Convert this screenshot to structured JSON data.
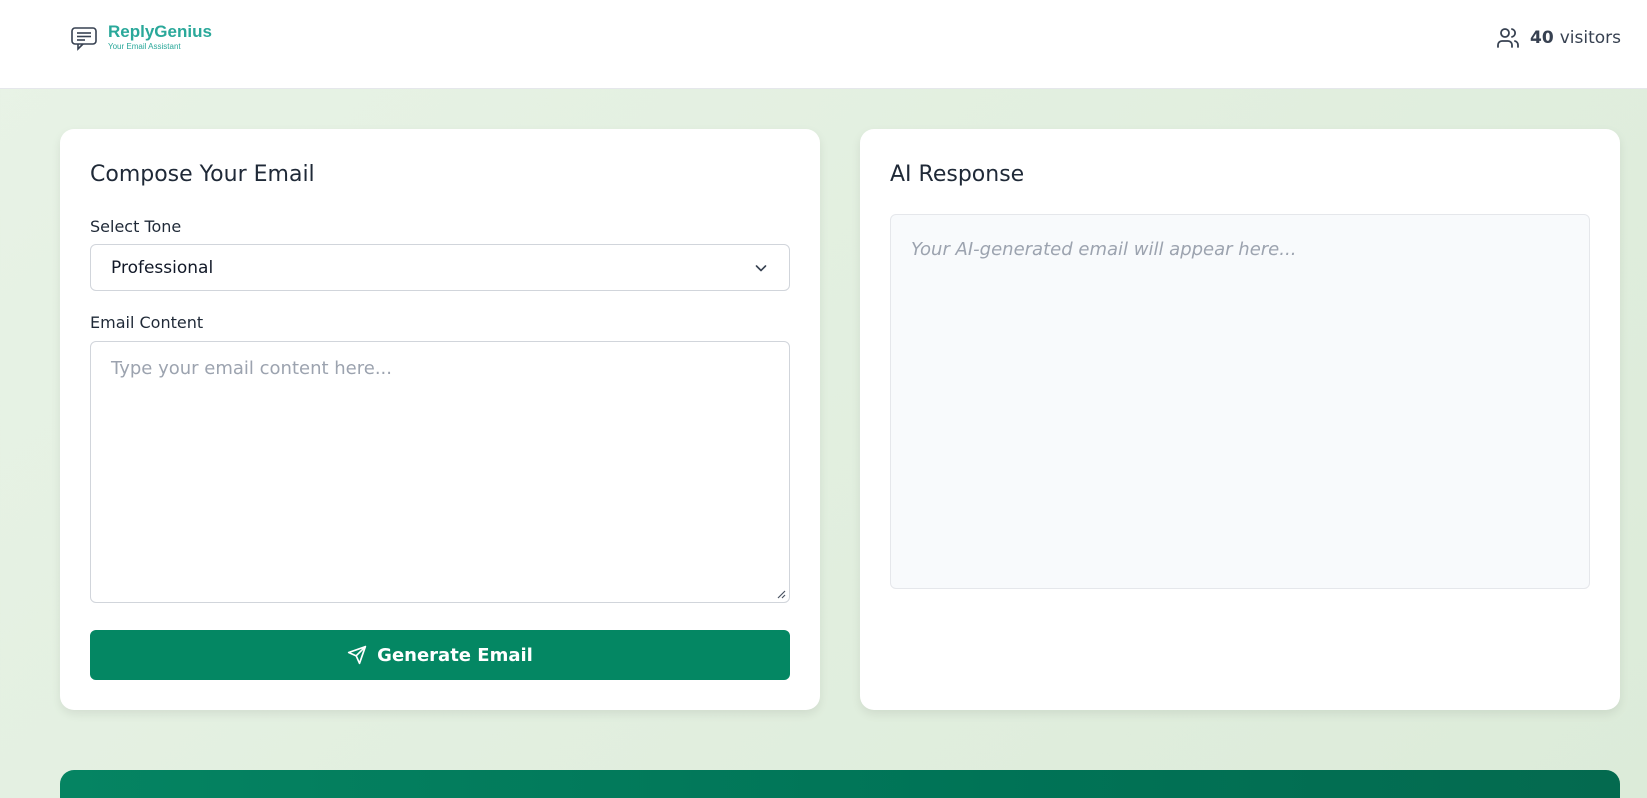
{
  "header": {
    "app_name": "ReplyGenius",
    "tagline": "Your Email Assistant",
    "visitors_count": "40",
    "visitors_label": "visitors"
  },
  "compose": {
    "title": "Compose Your Email",
    "tone_label": "Select Tone",
    "tone_value": "Professional",
    "content_label": "Email Content",
    "content_placeholder": "Type your email content here...",
    "generate_label": "Generate Email"
  },
  "response": {
    "title": "AI Response",
    "placeholder": "Your AI-generated email will appear here..."
  },
  "colors": {
    "brand": "#2aa89a",
    "primary_button": "#048763",
    "page_background": "#e3f0e0"
  },
  "icons": {
    "logo": "chat-bubble-icon",
    "visitors": "users-icon",
    "dropdown": "chevron-down-icon",
    "generate": "send-icon"
  }
}
